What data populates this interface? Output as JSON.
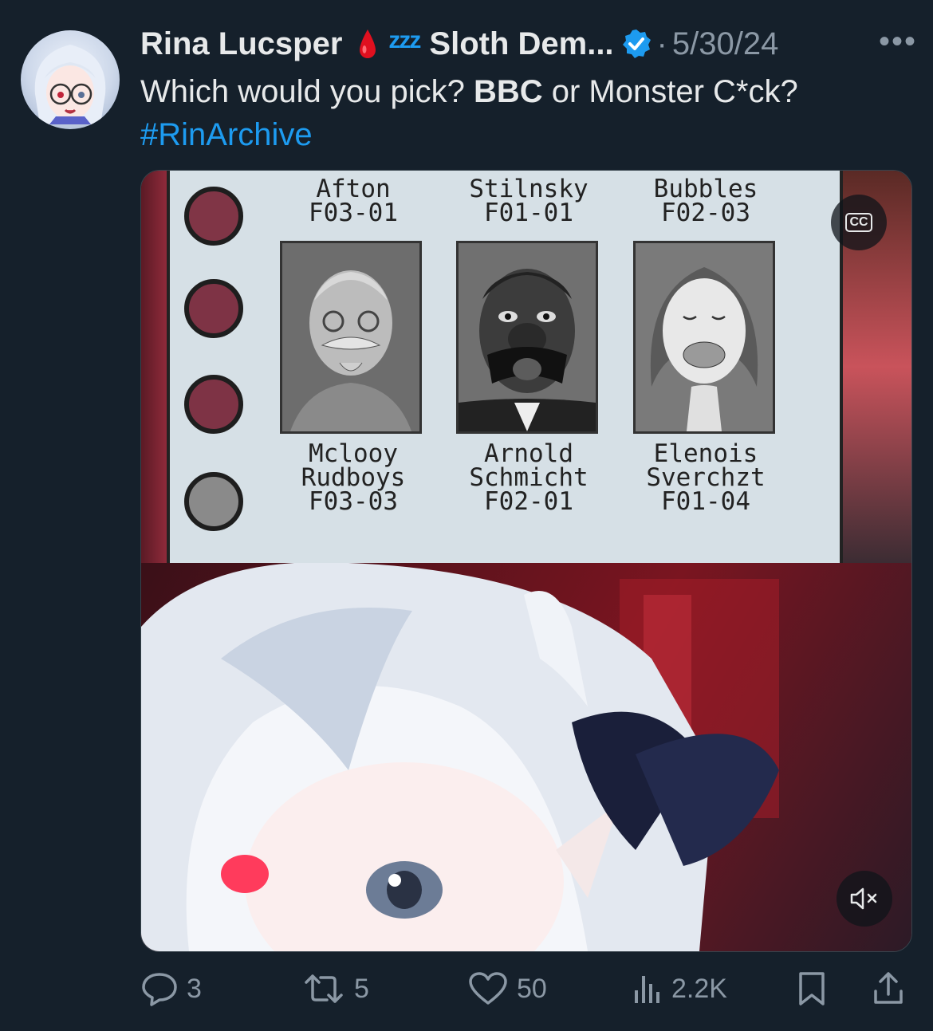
{
  "post": {
    "author_name": "Rina Lucsper",
    "status_emoji_text": "zzz",
    "display_name_suffix": "Sloth Dem...",
    "separator": "·",
    "date": "5/30/24",
    "more_label": "•••",
    "text_part1": "Which would you pick? ",
    "text_bold": "BBC",
    "text_part2": " or Monster C*ck?",
    "hashtag": "#RinArchive"
  },
  "media": {
    "cc_label": "CC",
    "dossier": {
      "top_row": [
        {
          "name": "Afton",
          "code": "F03-01"
        },
        {
          "name": "Stilnsky",
          "code": "F01-01"
        },
        {
          "name": "Bubbles",
          "code": "F02-03"
        }
      ],
      "bottom_row": [
        {
          "name1": "Mclooy",
          "name2": "Rudboys",
          "code": "F03-03"
        },
        {
          "name1": "Arnold",
          "name2": "Schmicht",
          "code": "F02-01"
        },
        {
          "name1": "Elenois",
          "name2": "Sverchzt",
          "code": "F01-04"
        }
      ]
    }
  },
  "actions": {
    "replies": "3",
    "reposts": "5",
    "likes": "50",
    "views": "2.2K"
  },
  "colors": {
    "background": "#15202b",
    "accent": "#1d9bf0",
    "muted": "#8b98a5",
    "text": "#e7e9ea"
  }
}
